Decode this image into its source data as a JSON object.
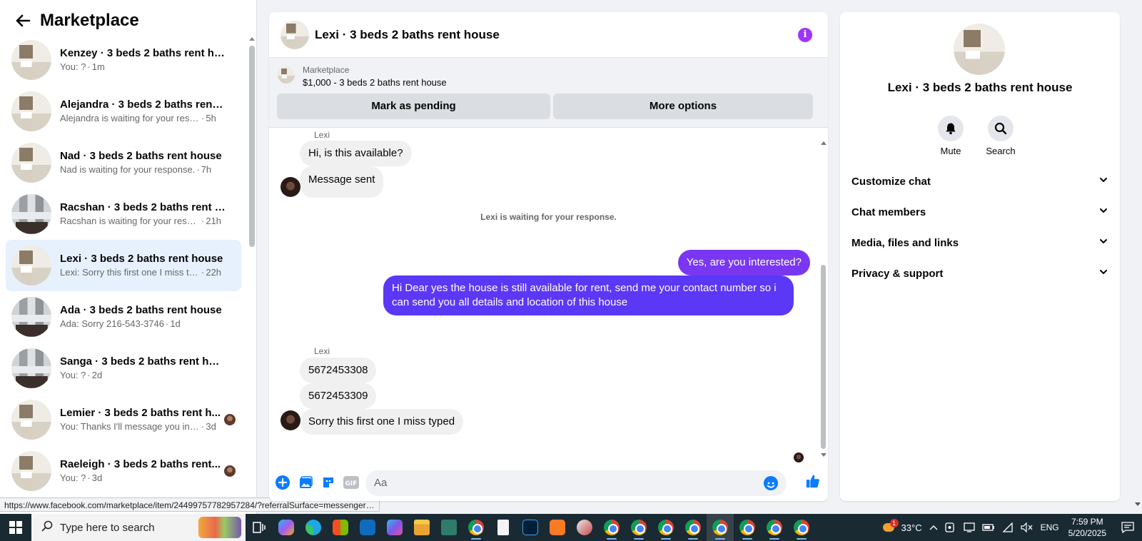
{
  "sidebar": {
    "title": "Marketplace",
    "conversations": [
      {
        "name": "Kenzey · 3 beds 2 baths rent ho...",
        "snippet": "You: ?",
        "time": "1m",
        "thumb": "house",
        "active": false,
        "mini": false
      },
      {
        "name": "Alejandra · 3 beds 2 baths rent h...",
        "snippet": "Alejandra is waiting for your respo...",
        "time": "5h",
        "thumb": "house",
        "active": false,
        "mini": false
      },
      {
        "name": "Nad · 3 beds 2 baths rent house",
        "snippet": "Nad is waiting for your response.",
        "time": "7h",
        "thumb": "house",
        "active": false,
        "mini": false
      },
      {
        "name": "Racshan · 3 beds 2 baths rent ho...",
        "snippet": "Racshan is waiting for your respo...",
        "time": "21h",
        "thumb": "kitchen",
        "active": false,
        "mini": false
      },
      {
        "name": "Lexi · 3 beds 2 baths rent house",
        "snippet": "Lexi: Sorry this first one I miss typ...",
        "time": "22h",
        "thumb": "house",
        "active": true,
        "mini": false
      },
      {
        "name": "Ada · 3 beds 2 baths rent house",
        "snippet": "Ada: Sorry 216-543-3746",
        "time": "1d",
        "thumb": "kitchen",
        "active": false,
        "mini": false
      },
      {
        "name": "Sanga · 3 beds 2 baths rent house",
        "snippet": "You: ?",
        "time": "2d",
        "thumb": "kitchen",
        "active": false,
        "mini": false
      },
      {
        "name": "Lemier · 3 beds 2 baths rent h...",
        "snippet": "You: Thanks I'll message you in ...",
        "time": "3d",
        "thumb": "house",
        "active": false,
        "mini": true
      },
      {
        "name": "Raeleigh · 3 beds 2 baths rent...",
        "snippet": "You: ?",
        "time": "3d",
        "thumb": "house",
        "active": false,
        "mini": true
      }
    ],
    "status_url": "https://www.facebook.com/marketplace/item/24499757782957284/?referralSurface=messenger_..."
  },
  "chat": {
    "title": "Lexi · 3 beds 2 baths rent house",
    "marketplace_label": "Marketplace",
    "listing": "$1,000 - 3 beds 2 baths rent house",
    "mark_pending": "Mark as pending",
    "more_options": "More options",
    "sender_name": "Lexi",
    "messages": {
      "m1": "Hi, is this available?",
      "m2": "Message sent",
      "system": "Lexi is waiting for your response.",
      "out1": "Yes, are you interested?",
      "out2": "Hi Dear yes the house is still available for rent, send me your contact number so i can send you all details and location of this house",
      "sender2": "Lexi",
      "m3": "5672453308",
      "m4": "5672453309",
      "m5": "Sorry this first one I miss typed"
    },
    "composer_placeholder": "Aa",
    "accent_color": "#7a37f2"
  },
  "panel": {
    "name": "Lexi · 3 beds 2 baths rent house",
    "mute": "Mute",
    "search": "Search",
    "sections": [
      "Customize chat",
      "Chat members",
      "Media, files and links",
      "Privacy & support"
    ]
  },
  "taskbar": {
    "search_placeholder": "Type here to search",
    "weather": "33°C",
    "language": "ENG",
    "time": "7:59 PM",
    "date": "5/20/2025",
    "weather_badge": "1"
  }
}
